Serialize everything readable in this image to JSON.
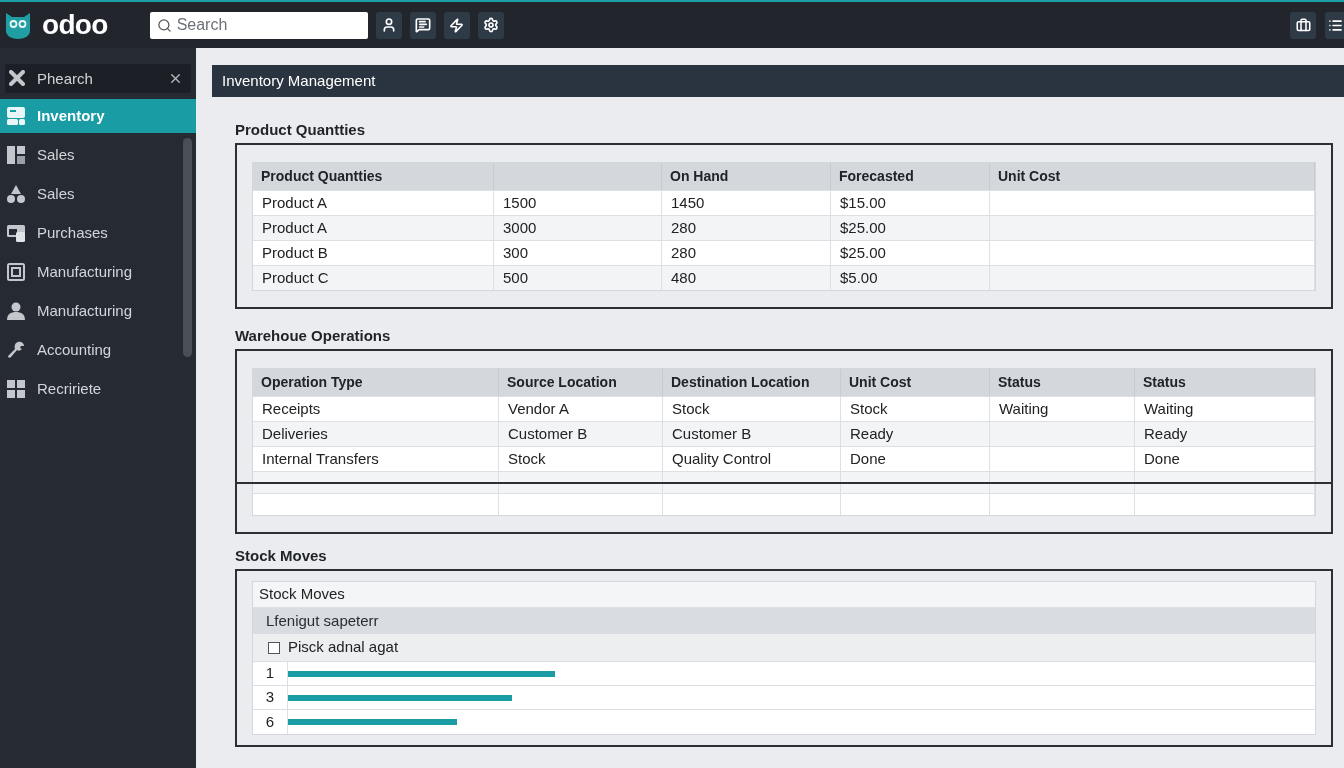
{
  "topbar": {
    "brand": "odoo",
    "search": {
      "placeholder": "Search"
    }
  },
  "sidebar": {
    "search": {
      "value": "Phearch"
    },
    "items": [
      {
        "label": "Inventory",
        "selected": true
      },
      {
        "label": "Sales",
        "selected": false
      },
      {
        "label": "Sales",
        "selected": false
      },
      {
        "label": "Purchases",
        "selected": false
      },
      {
        "label": "Manufacturing",
        "selected": false
      },
      {
        "label": "Manufacturing",
        "selected": false
      },
      {
        "label": "Accounting",
        "selected": false
      },
      {
        "label": "Recririete",
        "selected": false
      }
    ]
  },
  "page": {
    "title": "Inventory Management"
  },
  "sections": [
    {
      "kind": "table",
      "title": "Product Quantties",
      "table": {
        "columns": [
          "Product Quantties",
          null,
          "On Hand",
          "Forecasted",
          "Unit Cost"
        ],
        "rows": [
          [
            "Product A",
            "1500",
            "1450",
            "$15.00",
            null
          ],
          [
            "Product A",
            "3000",
            "280",
            "$25.00",
            null
          ],
          [
            "Product B",
            "300",
            "280",
            "$25.00",
            null
          ],
          [
            "Product C",
            "500",
            "480",
            "$5.00",
            null
          ]
        ]
      }
    },
    {
      "kind": "table",
      "title": "Warehoue Operations",
      "table": {
        "columns": [
          "Operation Type",
          "Source Location",
          "Destination Location",
          "Unit Cost",
          "Status",
          "Status"
        ],
        "rows": [
          [
            "Receipts",
            "Vendor A",
            "Stock",
            "Stock",
            "Waiting",
            "Waiting"
          ],
          [
            "Deliveries",
            "Customer B",
            "Customer B",
            "Ready",
            null,
            "Ready"
          ],
          [
            "Internal Transfers",
            "Stock",
            "Quality Control",
            "Done",
            null,
            "Done"
          ],
          [
            null,
            null,
            null,
            null,
            null,
            null
          ],
          [
            null,
            null,
            null,
            null,
            null,
            null
          ]
        ]
      }
    },
    {
      "kind": "moves",
      "title": "Stock Moves",
      "panel": {
        "title": "Stock Moves",
        "subheader": "Lfenigut sapeterr",
        "filter": {
          "label": "Pisck adnal agat",
          "checked": false
        },
        "rows": [
          {
            "label": "1",
            "level": 0.26
          },
          {
            "label": "3",
            "level": 0.218
          },
          {
            "label": "6",
            "level": 0.165
          }
        ]
      }
    }
  ]
}
